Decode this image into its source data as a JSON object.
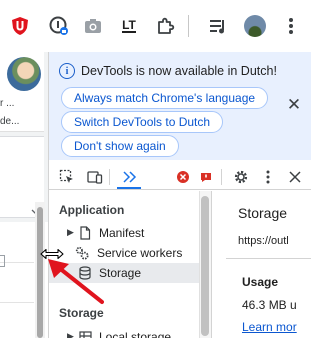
{
  "browser_toolbar": {
    "icons": [
      "ublock-extension-icon",
      "lastpass-extension-icon",
      "camera-extension-icon",
      "languagetool-extension-icon",
      "extensions-puzzle-icon",
      "media-control-icon",
      "profile-avatar-icon",
      "more-menu-icon"
    ],
    "languagetool_label": "LT"
  },
  "page": {
    "card_lines": [
      "r ...",
      "de..."
    ]
  },
  "devtools": {
    "infobar": {
      "message": "DevTools is now available in Dutch!",
      "buttons": [
        "Always match Chrome's language",
        "Switch DevTools to Dutch",
        "Don't show again"
      ],
      "close_glyph": "✕"
    },
    "tabbar": {
      "icons": [
        "inspect-element-icon",
        "device-toolbar-icon",
        "more-tabs-icon",
        "errors-icon",
        "issues-icon",
        "settings-icon",
        "more-options-icon",
        "close-devtools-icon"
      ]
    },
    "sidebar": {
      "application_heading": "Application",
      "items": [
        {
          "label": "Manifest",
          "icon": "file-icon"
        },
        {
          "label": "Service workers",
          "icon": "gears-icon"
        },
        {
          "label": "Storage",
          "icon": "database-icon",
          "selected": true
        }
      ],
      "storage_heading": "Storage",
      "storage_items": [
        {
          "label": "Local storage",
          "icon": "table-icon"
        }
      ]
    },
    "main": {
      "title": "Storage",
      "origin": "https://outl",
      "usage_heading": "Usage",
      "usage_amount": "46.3 MB u",
      "learn_more": "Learn mor"
    }
  },
  "colors": {
    "infobar_bg": "#e8f0fe",
    "link_blue": "#0b57d0",
    "annotation_red": "#e0141e"
  }
}
